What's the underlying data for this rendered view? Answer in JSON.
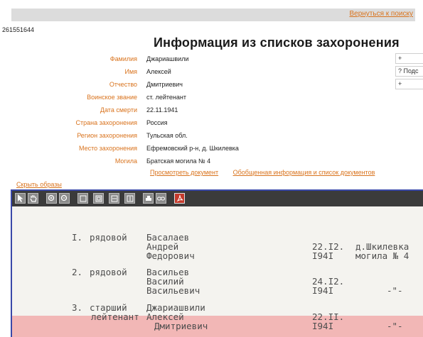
{
  "header": {
    "back_link": "Вернуться к поиску"
  },
  "record_id": "261551644",
  "title": "Информация из списков захоронения",
  "fields": [
    {
      "label": "Фамилия",
      "value": "Джариашвили"
    },
    {
      "label": "Имя",
      "value": "Алексей"
    },
    {
      "label": "Отчество",
      "value": "Дмитриевич"
    },
    {
      "label": "Воинское звание",
      "value": "ст. лейтенант"
    },
    {
      "label": "Дата смерти",
      "value": "22.11.1941"
    },
    {
      "label": "Страна захоронения",
      "value": "Россия"
    },
    {
      "label": "Регион захоронения",
      "value": "Тульская обл."
    },
    {
      "label": "Место захоронения",
      "value": "Ефремовский р-н, д. Шкилевка"
    },
    {
      "label": "Могила",
      "value": "Братская могила № 4"
    }
  ],
  "side_boxes": [
    "+",
    "? Подс",
    "+"
  ],
  "links": {
    "view_document": "Просмотреть документ",
    "summary": "Обобщенная информация и список документов",
    "hide_images": "Скрыть образы"
  },
  "viewer": {
    "tools": [
      "select-arrow-icon",
      "pan-hand-icon",
      "zoom-in-icon",
      "zoom-out-icon",
      "actual-size-icon",
      "fit-page-icon",
      "fit-width-icon",
      "fit-height-icon",
      "print-icon",
      "link-icon",
      "pdf-icon"
    ],
    "entries": [
      {
        "num": "I.",
        "rank": [
          "рядовой",
          ""
        ],
        "name": [
          "Басалаев",
          "Андрей",
          "Федорович"
        ],
        "date": [
          "22.I2.",
          "I94I"
        ],
        "place": [
          "д.Шкилевка",
          "могила № 4"
        ]
      },
      {
        "num": "2.",
        "rank": [
          "рядовой",
          ""
        ],
        "name": [
          "Васильев",
          "Василий",
          "Васильевич"
        ],
        "date": [
          "24.I2.",
          "I94I"
        ],
        "place": [
          "",
          "-\"-"
        ]
      },
      {
        "num": "3.",
        "rank": [
          "старший",
          "лейтенант"
        ],
        "name": [
          "Джариашвили",
          "Алексей",
          "Дмитриевич"
        ],
        "date": [
          "22.II.",
          "I94I"
        ],
        "place": [
          "",
          "-\"-"
        ]
      }
    ]
  }
}
